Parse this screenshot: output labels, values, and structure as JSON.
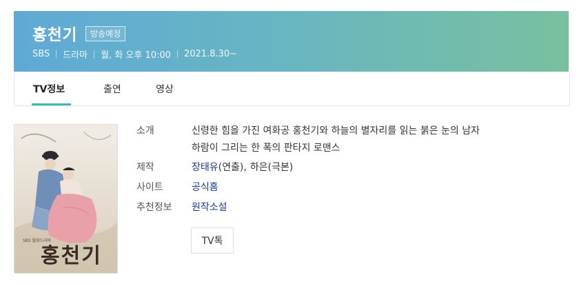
{
  "header": {
    "title": "홍천기",
    "badge": "방송예정",
    "meta": [
      "SBS",
      "드라마",
      "월, 화 오후 10:00",
      "2021.8.30~"
    ]
  },
  "tabs": [
    {
      "label": "TV정보",
      "active": true
    },
    {
      "label": "출연",
      "active": false
    },
    {
      "label": "영상",
      "active": false
    }
  ],
  "poster": {
    "alt": "홍천기 poster",
    "caption": "홍천기"
  },
  "info": {
    "intro_label": "소개",
    "intro_line1": "신령한 힘을 가진 여화공 홍천기와 하늘의 별자리를 읽는 붉은 눈의 남자",
    "intro_line2": "하람이 그리는 한 폭의 판타지 로맨스",
    "production_label": "제작",
    "director_name": "장태유",
    "director_role": "(연출),",
    "writer_name": "하은",
    "writer_role": "(극본)",
    "site_label": "사이트",
    "site_link": "공식홈",
    "rec_label": "추천정보",
    "rec_link": "원작소설",
    "tvtalk_button": "TV톡"
  },
  "colors": {
    "accent": "#3eb7b0",
    "link": "#1a3a8a",
    "header_start": "#5fa9d6",
    "header_end": "#79c09f"
  }
}
